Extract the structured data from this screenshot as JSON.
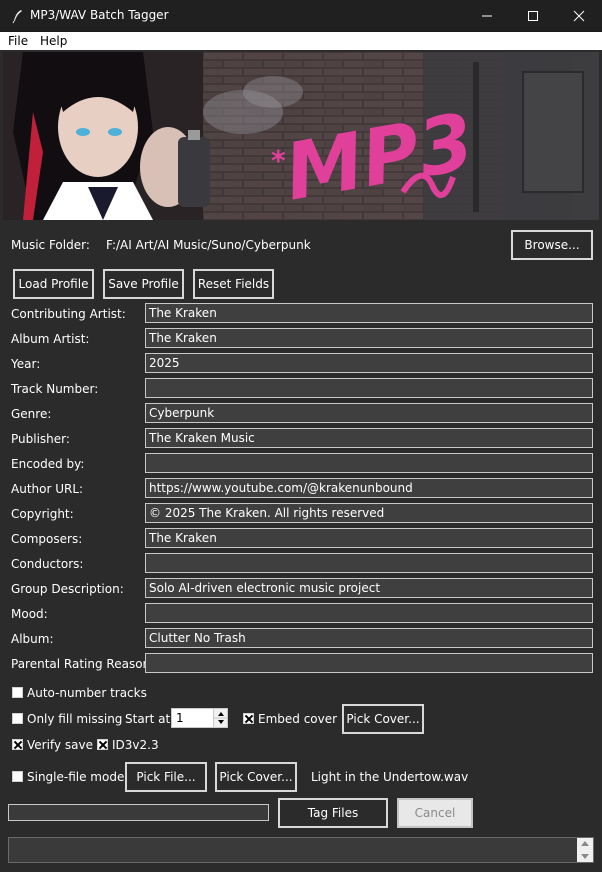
{
  "window": {
    "title": "MP3/WAV Batch Tagger",
    "icons": [
      "feather-icon",
      "minimize-icon",
      "maximize-icon",
      "close-icon"
    ]
  },
  "menu": {
    "file": "File",
    "help": "Help"
  },
  "folder": {
    "label": "Music Folder:",
    "path": "F:/AI Art/AI Music/Suno/Cyberpunk",
    "browse": "Browse..."
  },
  "profile": {
    "load": "Load Profile",
    "save": "Save Profile",
    "reset": "Reset Fields"
  },
  "fields": [
    {
      "label": "Contributing Artist:",
      "value": "The Kraken"
    },
    {
      "label": "Album Artist:",
      "value": "The Kraken"
    },
    {
      "label": "Year:",
      "value": "2025"
    },
    {
      "label": "Track Number:",
      "value": ""
    },
    {
      "label": "Genre:",
      "value": "Cyberpunk"
    },
    {
      "label": "Publisher:",
      "value": "The Kraken Music"
    },
    {
      "label": "Encoded by:",
      "value": ""
    },
    {
      "label": "Author URL:",
      "value": "https://www.youtube.com/@krakenunbound"
    },
    {
      "label": "Copyright:",
      "value": "© 2025 The Kraken. All rights reserved"
    },
    {
      "label": "Composers:",
      "value": "The Kraken"
    },
    {
      "label": "Conductors:",
      "value": ""
    },
    {
      "label": "Group Description:",
      "value": "Solo AI-driven electronic music project"
    },
    {
      "label": "Mood:",
      "value": ""
    },
    {
      "label": "Album:",
      "value": "Clutter No Trash"
    },
    {
      "label": "Parental Rating Reason:",
      "value": ""
    }
  ],
  "options": {
    "auto_number": {
      "label": "Auto-number tracks",
      "checked": false
    },
    "only_fill_missing": {
      "label": "Only fill missing",
      "checked": false
    },
    "start_at_label": "Start at:",
    "start_at_value": "1",
    "embed_cover": {
      "label": "Embed cover",
      "checked": true
    },
    "pick_cover": "Pick Cover...",
    "verify_save": {
      "label": "Verify save",
      "checked": true
    },
    "id3v23": {
      "label": "ID3v2.3",
      "checked": true
    },
    "single_file": {
      "label": "Single-file mode",
      "checked": false
    },
    "pick_file": "Pick File...",
    "pick_cover_single": "Pick Cover...",
    "selected_file": "Light in the Undertow.wav"
  },
  "actions": {
    "tag_files": "Tag Files",
    "cancel": "Cancel",
    "progress": 0
  },
  "banner": {
    "graffiti_text": "MP3"
  },
  "colors": {
    "window_bg": "#2b2b2b",
    "titlebar_bg": "#202020",
    "graffiti_pink": "#e0409a"
  }
}
